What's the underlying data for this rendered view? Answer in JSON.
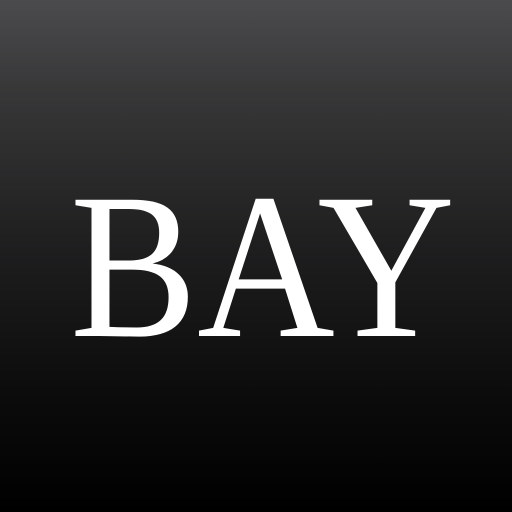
{
  "logo": {
    "text": "BAY",
    "text_color": "#ffffff",
    "background_top": "#4b4b4d",
    "background_bottom": "#000000"
  }
}
